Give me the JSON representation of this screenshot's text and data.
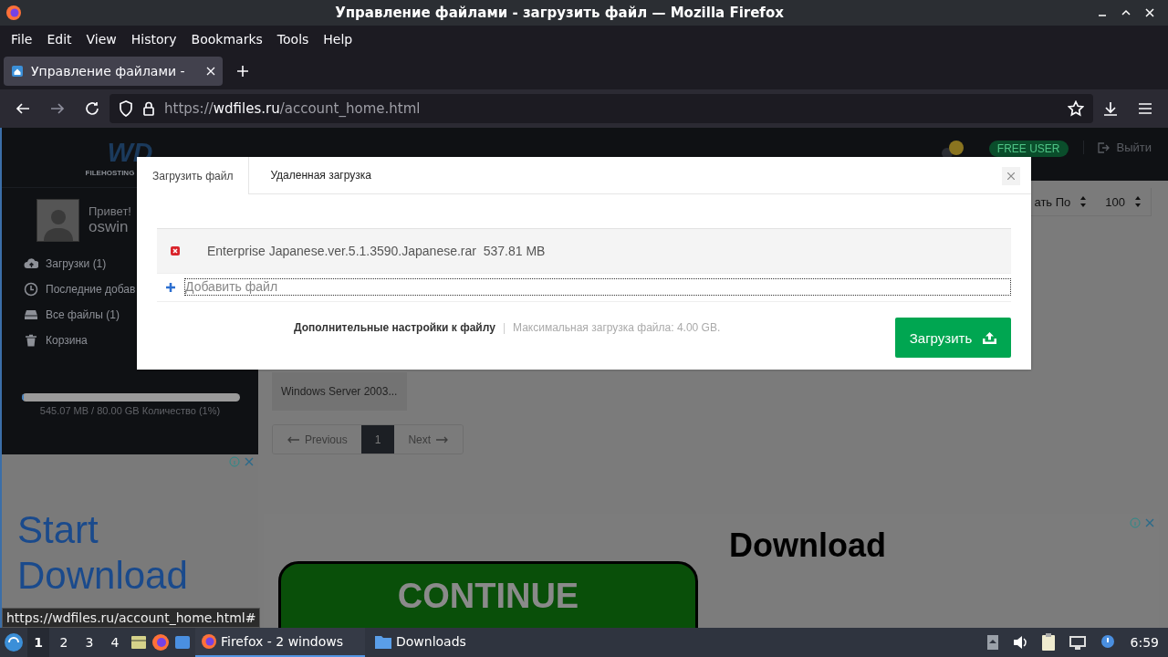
{
  "window": {
    "title": "Управление файлами - загрузить файл — Mozilla Firefox"
  },
  "menu": [
    "File",
    "Edit",
    "View",
    "History",
    "Bookmarks",
    "Tools",
    "Help"
  ],
  "tabs": [
    {
      "label": "Управление файлами -",
      "selected": true
    }
  ],
  "address": {
    "scheme": "https://",
    "domain": "wdfiles.ru",
    "path": "/account_home.html"
  },
  "site": {
    "logo": {
      "mark": "WD",
      "text": "FILEHOSTING"
    },
    "badge": "FREE USER",
    "logout": "Выйти",
    "greeting": "Привет!",
    "username": "oswin",
    "sidebar": [
      {
        "label": "Загрузки (1)",
        "kind": "cloud"
      },
      {
        "label": "Последние добав",
        "kind": "clock"
      },
      {
        "label": "Все файлы (1)",
        "kind": "drive"
      },
      {
        "label": "Корзина",
        "kind": "trash"
      }
    ],
    "storage": {
      "level": 0.01,
      "reading": "545.07 MB / 80.00 GB Количество (1%)"
    },
    "sort_label": "ать По",
    "per_page": "100",
    "file_card": "Windows Server 2003...",
    "pagination": [
      {
        "label": "Previous",
        "kind": "prev",
        "selected": false
      },
      {
        "label": "1",
        "kind": "page",
        "selected": true
      },
      {
        "label": "Next",
        "kind": "next",
        "selected": false
      }
    ]
  },
  "modal": {
    "tabs": [
      {
        "label": "Загрузить файл",
        "selected": true
      },
      {
        "label": "Удаленная загрузка",
        "selected": false
      }
    ],
    "files": [
      {
        "name": "Enterprise Japanese.ver.5.1.3590.Japanese.rar",
        "size": "537.81 MB"
      }
    ],
    "add_file": "Добавить файл",
    "options_link": "Дополнительные настройки к файлу",
    "separator": "|",
    "max_size": "Максимальная загрузка файла: 4.00 GB.",
    "upload_button": "Загрузить"
  },
  "ads": {
    "left": [
      "Start",
      "Download"
    ],
    "right_title": "Download",
    "right_button": "CONTINUE"
  },
  "status_link": "https://wdfiles.ru/account_home.html#",
  "taskbar": {
    "workspaces": [
      {
        "label": "1",
        "selected": true
      },
      {
        "label": "2",
        "selected": false
      },
      {
        "label": "3",
        "selected": false
      },
      {
        "label": "4",
        "selected": false
      }
    ],
    "windows": [
      {
        "label": "Firefox - 2 windows",
        "kind": "firefox",
        "selected": true
      },
      {
        "label": "Downloads",
        "kind": "folder",
        "selected": false
      }
    ],
    "clock": "6:59"
  }
}
